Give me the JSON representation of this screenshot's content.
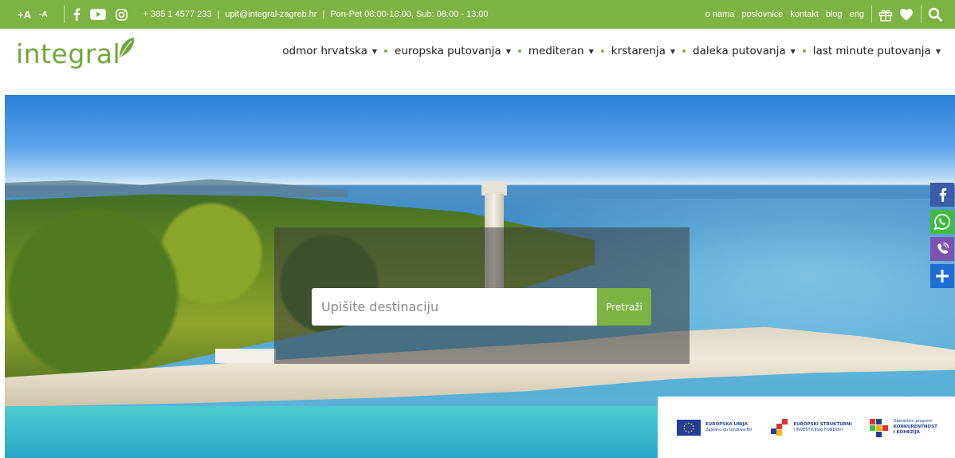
{
  "topbar": {
    "font_increase": "+A",
    "font_decrease": "-A",
    "phone": "+ 385 1 4577 233",
    "email": "upit@integral-zagreb.hr",
    "hours": "Pon-Pet 08:00-18:00, Sub: 08:00 - 13:00",
    "links": [
      "o nama",
      "poslovnice",
      "kontakt",
      "blog",
      "eng"
    ],
    "icons": [
      "gift-icon",
      "heart-icon",
      "search-icon"
    ]
  },
  "logo": {
    "text": "integral"
  },
  "nav": [
    {
      "label": "odmor hrvatska"
    },
    {
      "label": "europska putovanja"
    },
    {
      "label": "mediteran"
    },
    {
      "label": "krstarenja"
    },
    {
      "label": "daleka putovanja"
    },
    {
      "label": "last minute putovanja"
    }
  ],
  "search": {
    "placeholder": "Upišite destinaciju",
    "button": "Pretraži"
  },
  "share": [
    "facebook-icon",
    "whatsapp-icon",
    "viber-icon",
    "plus-icon"
  ],
  "eu": {
    "eu_title": "EUROPSKA UNIJA",
    "eu_sub": "Zajedno do fondova EU",
    "fund_title": "EUROPSKI STRUKTURNI",
    "fund_sub": "I INVESTICIJSKI FONDOVI",
    "op_title": "Operativni program",
    "op_sub1": "KONKURENTNOST",
    "op_sub2": "I KOHEZIJA"
  },
  "colors": {
    "brand_green": "#7cb342",
    "facebook": "#3b5ca8",
    "whatsapp": "#3fbb42",
    "viber": "#7b53b0",
    "plus": "#1f6ed4"
  }
}
